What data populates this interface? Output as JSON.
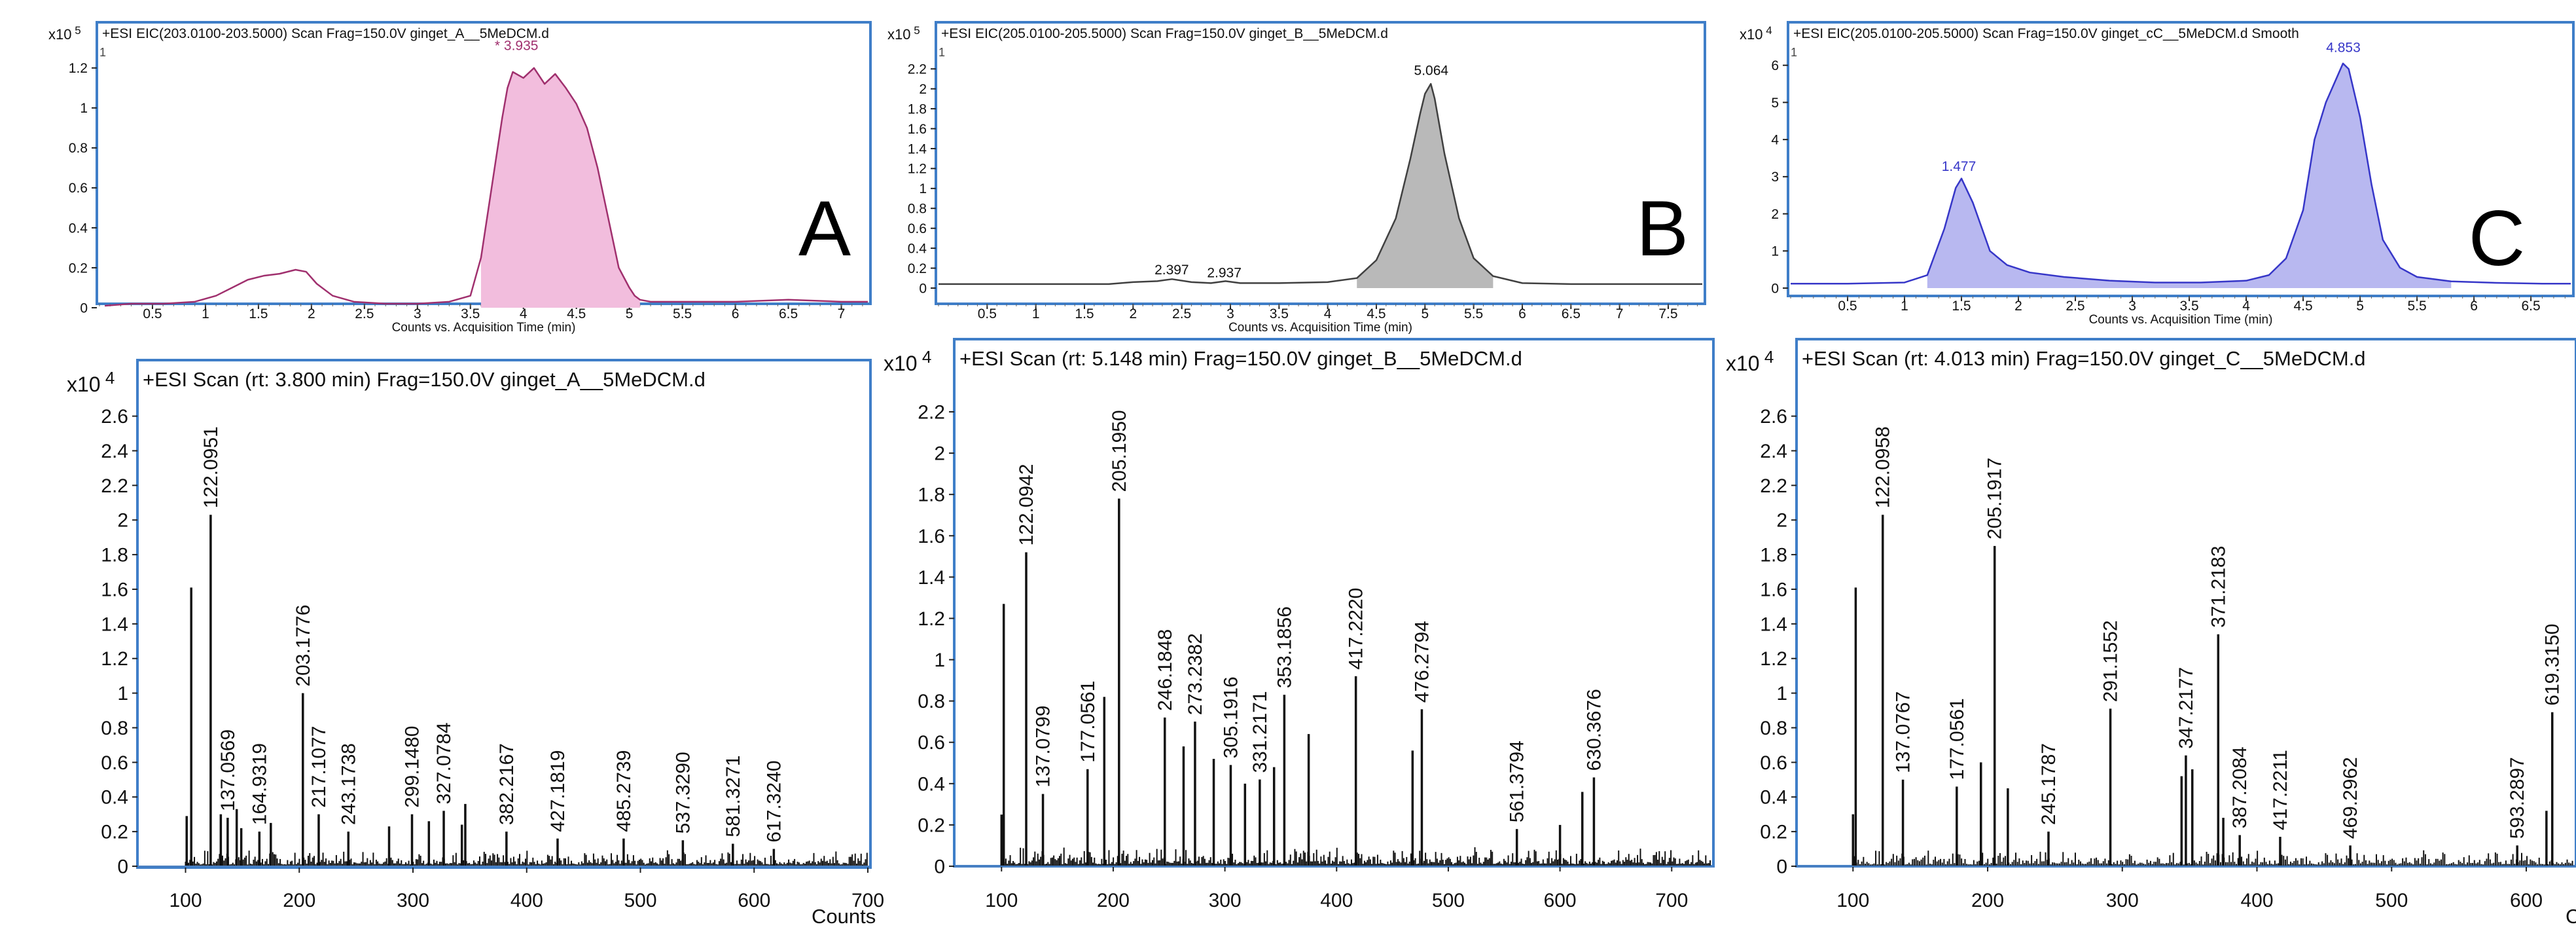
{
  "chart_data": [
    {
      "id": "A_eic",
      "type": "area",
      "multiplier": "x10",
      "exponent": "5",
      "corner_tag": "1",
      "header": "+ESI EIC(203.0100-203.5000) Scan Frag=150.0V ginget_A__5MeDCM.d",
      "panel_label": "A",
      "xlabel": "Counts vs. Acquisition Time (min)",
      "xlim": [
        0,
        7.25
      ],
      "ylim": [
        0,
        1.35
      ],
      "xticks": [
        "0.5",
        "1",
        "1.5",
        "2",
        "2.5",
        "3",
        "3.5",
        "4",
        "4.5",
        "5",
        "5.5",
        "6",
        "6.5",
        "7"
      ],
      "yticks": [
        "0",
        "0.2",
        "0.4",
        "0.6",
        "0.8",
        "1",
        "1.2"
      ],
      "color": "#a0306e",
      "fill": "#f2bddd",
      "fill_range": [
        3.55,
        5.15
      ],
      "peak_marker": "*",
      "peak_labels": [
        {
          "x": 3.935,
          "y": 1.27,
          "text": "3.935"
        }
      ],
      "series": [
        {
          "x": [
            0.05,
            0.3,
            0.6,
            0.9,
            1.1,
            1.25,
            1.4,
            1.55,
            1.7,
            1.85,
            1.95,
            2.05,
            2.2,
            2.4,
            2.7,
            3.0,
            3.3,
            3.5,
            3.6,
            3.7,
            3.8,
            3.85,
            3.9,
            4.0,
            4.1,
            4.2,
            4.3,
            4.4,
            4.5,
            4.6,
            4.7,
            4.8,
            4.9,
            5.0,
            5.05,
            5.1,
            5.2,
            5.5,
            6.0,
            6.5,
            7.0,
            7.25
          ],
          "y": [
            0.01,
            0.02,
            0.02,
            0.03,
            0.06,
            0.1,
            0.14,
            0.16,
            0.17,
            0.19,
            0.18,
            0.12,
            0.06,
            0.03,
            0.02,
            0.02,
            0.03,
            0.06,
            0.25,
            0.6,
            0.95,
            1.1,
            1.18,
            1.15,
            1.2,
            1.12,
            1.17,
            1.1,
            1.02,
            0.9,
            0.7,
            0.45,
            0.2,
            0.1,
            0.06,
            0.04,
            0.03,
            0.03,
            0.03,
            0.04,
            0.03,
            0.03
          ]
        }
      ]
    },
    {
      "id": "B_eic",
      "type": "area",
      "multiplier": "x10",
      "exponent": "5",
      "corner_tag": "1",
      "header": "+ESI EIC(205.0100-205.5000) Scan Frag=150.0V ginget_B__5MeDCM.d",
      "panel_label": "B",
      "xlabel": "Counts vs. Acquisition Time (min)",
      "xlim": [
        0,
        7.85
      ],
      "ylim": [
        0,
        2.3
      ],
      "xticks": [
        "0.5",
        "1",
        "1.5",
        "2",
        "2.5",
        "3",
        "3.5",
        "4",
        "4.5",
        "5",
        "5.5",
        "6",
        "6.5",
        "7",
        "7.5"
      ],
      "yticks": [
        "0",
        "0.2",
        "0.4",
        "0.6",
        "0.8",
        "1",
        "1.2",
        "1.4",
        "1.6",
        "1.8",
        "2",
        "2.2"
      ],
      "color": "#404040",
      "fill": "#b9b9b9",
      "fill_range": [
        4.3,
        5.9
      ],
      "peak_labels": [
        {
          "x": 5.064,
          "y": 2.1,
          "text": "5.064"
        },
        {
          "x": 2.397,
          "y": 0.1,
          "text": "2.397"
        },
        {
          "x": 2.937,
          "y": 0.07,
          "text": "2.937"
        }
      ],
      "series": [
        {
          "x": [
            0.0,
            0.5,
            1.0,
            1.5,
            1.75,
            2.0,
            2.25,
            2.4,
            2.6,
            2.8,
            2.95,
            3.1,
            3.5,
            4.0,
            4.3,
            4.5,
            4.7,
            4.85,
            4.95,
            5.0,
            5.06,
            5.1,
            5.2,
            5.35,
            5.5,
            5.7,
            6.0,
            6.5,
            7.0,
            7.5,
            7.85
          ],
          "y": [
            0.04,
            0.04,
            0.04,
            0.04,
            0.04,
            0.06,
            0.07,
            0.09,
            0.06,
            0.05,
            0.07,
            0.05,
            0.05,
            0.06,
            0.1,
            0.28,
            0.7,
            1.3,
            1.75,
            1.95,
            2.05,
            1.9,
            1.35,
            0.7,
            0.3,
            0.12,
            0.05,
            0.04,
            0.04,
            0.04,
            0.04
          ]
        }
      ]
    },
    {
      "id": "C_eic",
      "type": "area",
      "multiplier": "x10",
      "exponent": "4",
      "corner_tag": "1",
      "header": "+ESI EIC(205.0100-205.5000) Scan Frag=150.0V ginget_cC__5MeDCM.d  Smooth",
      "panel_label": "C",
      "xlabel": "Counts vs. Acquisition Time (min)",
      "xlim": [
        0,
        6.85
      ],
      "ylim": [
        0,
        6.7
      ],
      "xticks": [
        "0.5",
        "1",
        "1.5",
        "2",
        "2.5",
        "3",
        "3.5",
        "4",
        "4.5",
        "5",
        "5.5",
        "6",
        "6.5"
      ],
      "yticks": [
        "0",
        "1",
        "2",
        "3",
        "4",
        "5",
        "6"
      ],
      "color": "#3636c8",
      "fill": "#b8b8f0",
      "fill_range": [
        1.2,
        5.9
      ],
      "peak_labels": [
        {
          "x": 1.477,
          "y": 3.05,
          "text": "1.477"
        },
        {
          "x": 4.853,
          "y": 6.25,
          "text": "4.853"
        }
      ],
      "series": [
        {
          "x": [
            0.0,
            0.5,
            1.0,
            1.2,
            1.35,
            1.45,
            1.5,
            1.6,
            1.75,
            1.9,
            2.1,
            2.4,
            2.8,
            3.2,
            3.6,
            4.0,
            4.2,
            4.35,
            4.5,
            4.6,
            4.7,
            4.8,
            4.85,
            4.9,
            5.0,
            5.1,
            5.2,
            5.35,
            5.5,
            5.8,
            6.2,
            6.6,
            6.85
          ],
          "y": [
            0.12,
            0.12,
            0.15,
            0.35,
            1.6,
            2.7,
            2.95,
            2.3,
            1.0,
            0.62,
            0.42,
            0.3,
            0.2,
            0.15,
            0.15,
            0.2,
            0.35,
            0.8,
            2.1,
            4.0,
            5.0,
            5.7,
            6.05,
            5.9,
            4.6,
            2.8,
            1.3,
            0.55,
            0.3,
            0.18,
            0.14,
            0.12,
            0.12
          ]
        }
      ]
    },
    {
      "id": "A_ms",
      "type": "bar",
      "multiplier": "x10",
      "exponent": "4",
      "header": "+ESI Scan (rt: 3.800 min) Frag=150.0V ginget_A__5MeDCM.d",
      "xlabel": "Counts",
      "xlim": [
        60,
        700
      ],
      "ylim": [
        0,
        2.78
      ],
      "xticks": [
        "100",
        "200",
        "300",
        "400",
        "500",
        "600",
        "700"
      ],
      "yticks": [
        "0",
        "0.2",
        "0.4",
        "0.6",
        "0.8",
        "1",
        "1.2",
        "1.4",
        "1.6",
        "1.8",
        "2",
        "2.2",
        "2.4",
        "2.6"
      ],
      "peaks": [
        {
          "mz": 105.0,
          "i": 1.61,
          "label": ""
        },
        {
          "mz": 122.0951,
          "i": 2.03,
          "label": "122.0951"
        },
        {
          "mz": 137.0569,
          "i": 0.28,
          "label": "137.0569"
        },
        {
          "mz": 164.9319,
          "i": 0.2,
          "label": "164.9319"
        },
        {
          "mz": 203.1776,
          "i": 1.0,
          "label": "203.1776"
        },
        {
          "mz": 217.1077,
          "i": 0.3,
          "label": "217.1077"
        },
        {
          "mz": 243.1738,
          "i": 0.2,
          "label": "243.1738"
        },
        {
          "mz": 299.148,
          "i": 0.3,
          "label": "299.1480"
        },
        {
          "mz": 327.0784,
          "i": 0.32,
          "label": "327.0784"
        },
        {
          "mz": 382.2167,
          "i": 0.2,
          "label": "382.2167"
        },
        {
          "mz": 427.1819,
          "i": 0.16,
          "label": "427.1819"
        },
        {
          "mz": 485.2739,
          "i": 0.16,
          "label": "485.2739"
        },
        {
          "mz": 537.329,
          "i": 0.15,
          "label": "537.3290"
        },
        {
          "mz": 581.3271,
          "i": 0.13,
          "label": "581.3271"
        },
        {
          "mz": 617.324,
          "i": 0.1,
          "label": "617.3240"
        },
        {
          "mz": 101.0,
          "i": 0.29,
          "label": ""
        },
        {
          "mz": 131.0,
          "i": 0.3,
          "label": ""
        },
        {
          "mz": 145.0,
          "i": 0.33,
          "label": ""
        },
        {
          "mz": 149.0,
          "i": 0.22,
          "label": ""
        },
        {
          "mz": 175.0,
          "i": 0.25,
          "label": ""
        },
        {
          "mz": 279.0,
          "i": 0.23,
          "label": ""
        },
        {
          "mz": 314.0,
          "i": 0.26,
          "label": ""
        },
        {
          "mz": 346.0,
          "i": 0.36,
          "label": ""
        },
        {
          "mz": 343.0,
          "i": 0.24,
          "label": ""
        }
      ]
    },
    {
      "id": "B_ms",
      "type": "bar",
      "multiplier": "x10",
      "exponent": "4",
      "header": "+ESI Scan (rt: 5.148 min) Frag=150.0V ginget_B__5MeDCM.d",
      "xlabel": "",
      "xlim": [
        60,
        735
      ],
      "ylim": [
        0,
        2.33
      ],
      "xticks": [
        "100",
        "200",
        "300",
        "400",
        "500",
        "600",
        "700"
      ],
      "yticks": [
        "0",
        "0.2",
        "0.4",
        "0.6",
        "0.8",
        "1",
        "1.2",
        "1.4",
        "1.6",
        "1.8",
        "2",
        "2.2"
      ],
      "peaks": [
        {
          "mz": 102.0,
          "i": 1.27,
          "label": ""
        },
        {
          "mz": 122.0942,
          "i": 1.52,
          "label": "122.0942"
        },
        {
          "mz": 137.0799,
          "i": 0.35,
          "label": "137.0799"
        },
        {
          "mz": 177.0561,
          "i": 0.47,
          "label": "177.0561"
        },
        {
          "mz": 205.195,
          "i": 1.78,
          "label": "205.1950"
        },
        {
          "mz": 246.1848,
          "i": 0.72,
          "label": "246.1848"
        },
        {
          "mz": 273.2382,
          "i": 0.7,
          "label": "273.2382"
        },
        {
          "mz": 305.1916,
          "i": 0.49,
          "label": "305.1916"
        },
        {
          "mz": 331.2171,
          "i": 0.42,
          "label": "331.2171"
        },
        {
          "mz": 353.1856,
          "i": 0.83,
          "label": "353.1856"
        },
        {
          "mz": 417.222,
          "i": 0.92,
          "label": "417.2220"
        },
        {
          "mz": 476.2794,
          "i": 0.76,
          "label": "476.2794"
        },
        {
          "mz": 561.3794,
          "i": 0.18,
          "label": "561.3794"
        },
        {
          "mz": 630.3676,
          "i": 0.43,
          "label": "630.3676"
        },
        {
          "mz": 100.0,
          "i": 0.25,
          "label": ""
        },
        {
          "mz": 192.0,
          "i": 0.82,
          "label": ""
        },
        {
          "mz": 263.0,
          "i": 0.58,
          "label": ""
        },
        {
          "mz": 290.0,
          "i": 0.52,
          "label": ""
        },
        {
          "mz": 318.0,
          "i": 0.4,
          "label": ""
        },
        {
          "mz": 344.0,
          "i": 0.48,
          "label": ""
        },
        {
          "mz": 375.0,
          "i": 0.64,
          "label": ""
        },
        {
          "mz": 468.0,
          "i": 0.56,
          "label": ""
        },
        {
          "mz": 620.0,
          "i": 0.36,
          "label": ""
        },
        {
          "mz": 600.0,
          "i": 0.2,
          "label": ""
        }
      ]
    },
    {
      "id": "C_ms",
      "type": "bar",
      "multiplier": "x10",
      "exponent": "4",
      "header": "+ESI Scan (rt: 4.013 min) Frag=150.0V ginget_C__5MeDCM.d",
      "xlabel": "Counts",
      "xlim": [
        60,
        635
      ],
      "ylim": [
        0,
        2.78
      ],
      "xticks": [
        "100",
        "200",
        "300",
        "400",
        "500",
        "600"
      ],
      "yticks": [
        "0",
        "0.2",
        "0.4",
        "0.6",
        "0.8",
        "1",
        "1.2",
        "1.4",
        "1.6",
        "1.8",
        "2",
        "2.2",
        "2.4",
        "2.6"
      ],
      "peaks": [
        {
          "mz": 102.0,
          "i": 1.61,
          "label": ""
        },
        {
          "mz": 122.0958,
          "i": 2.03,
          "label": "122.0958"
        },
        {
          "mz": 137.0767,
          "i": 0.5,
          "label": "137.0767"
        },
        {
          "mz": 177.0561,
          "i": 0.46,
          "label": "177.0561"
        },
        {
          "mz": 205.1917,
          "i": 1.85,
          "label": "205.1917"
        },
        {
          "mz": 245.1787,
          "i": 0.2,
          "label": "245.1787"
        },
        {
          "mz": 291.1552,
          "i": 0.91,
          "label": "291.1552"
        },
        {
          "mz": 347.2177,
          "i": 0.64,
          "label": "347.2177"
        },
        {
          "mz": 371.2183,
          "i": 1.34,
          "label": "371.2183"
        },
        {
          "mz": 387.2084,
          "i": 0.18,
          "label": "387.2084"
        },
        {
          "mz": 417.2211,
          "i": 0.17,
          "label": "417.2211"
        },
        {
          "mz": 469.2962,
          "i": 0.12,
          "label": "469.2962"
        },
        {
          "mz": 593.2897,
          "i": 0.12,
          "label": "593.2897"
        },
        {
          "mz": 619.315,
          "i": 0.89,
          "label": "619.3150"
        },
        {
          "mz": 100.0,
          "i": 0.3,
          "label": ""
        },
        {
          "mz": 195.0,
          "i": 0.6,
          "label": ""
        },
        {
          "mz": 215.0,
          "i": 0.45,
          "label": ""
        },
        {
          "mz": 344.0,
          "i": 0.52,
          "label": ""
        },
        {
          "mz": 352.0,
          "i": 0.56,
          "label": ""
        },
        {
          "mz": 375.0,
          "i": 0.28,
          "label": ""
        },
        {
          "mz": 615.0,
          "i": 0.32,
          "label": ""
        }
      ]
    }
  ]
}
